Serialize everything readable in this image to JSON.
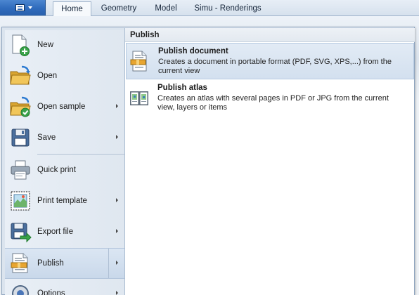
{
  "ribbon": {
    "app_menu_button": "application-menu",
    "tabs": [
      {
        "label": "Home",
        "active": true
      },
      {
        "label": "Geometry",
        "active": false
      },
      {
        "label": "Model",
        "active": false
      },
      {
        "label": "Simu - Renderings",
        "active": false
      }
    ]
  },
  "menu": {
    "items": [
      {
        "label": "New",
        "icon": "new-document-icon",
        "has_submenu": false
      },
      {
        "label": "Open",
        "icon": "open-folder-icon",
        "has_submenu": false
      },
      {
        "label": "Open sample",
        "icon": "open-sample-icon",
        "has_submenu": true
      },
      {
        "label": "Save",
        "icon": "save-icon",
        "has_submenu": true
      },
      {
        "label": "Quick print",
        "icon": "printer-icon",
        "has_submenu": false
      },
      {
        "label": "Print template",
        "icon": "print-template-icon",
        "has_submenu": true
      },
      {
        "label": "Export file",
        "icon": "export-file-icon",
        "has_submenu": true
      },
      {
        "label": "Publish",
        "icon": "publish-icon",
        "has_submenu": true,
        "selected": true
      },
      {
        "label": "Options",
        "icon": "options-icon",
        "has_submenu": true
      }
    ]
  },
  "submenu": {
    "title": "Publish",
    "items": [
      {
        "title": "Publish document",
        "description": "Creates a document in portable format (PDF, SVG, XPS,...) from the current view",
        "icon": "publish-document-icon",
        "highlighted": true
      },
      {
        "title": "Publish atlas",
        "description": "Creates an atlas with several pages in PDF or JPG from the current view, layers or items",
        "icon": "publish-atlas-icon",
        "highlighted": false
      }
    ]
  },
  "colors": {
    "app_button": "#2f6bbc",
    "highlight": "#d3e0ef",
    "menu_background": "#dbe4ee"
  }
}
